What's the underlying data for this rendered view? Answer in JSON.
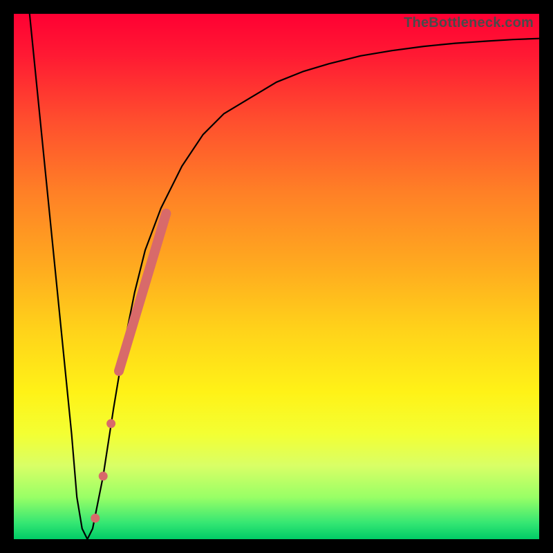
{
  "watermark": "TheBottleneck.com",
  "chart_data": {
    "type": "line",
    "title": "",
    "xlabel": "",
    "ylabel": "",
    "xlim": [
      0,
      100
    ],
    "ylim": [
      0,
      100
    ],
    "grid": false,
    "series": [
      {
        "name": "bottleneck-curve",
        "color": "#000000",
        "x": [
          3,
          5,
          7,
          9,
          11,
          12,
          13,
          14,
          15,
          17,
          19,
          21,
          23,
          25,
          28,
          32,
          36,
          40,
          45,
          50,
          55,
          60,
          66,
          72,
          78,
          84,
          90,
          95,
          100
        ],
        "y": [
          100,
          80,
          60,
          40,
          20,
          8,
          2,
          0,
          2,
          12,
          25,
          37,
          47,
          55,
          63,
          71,
          77,
          81,
          84,
          87,
          89,
          90.5,
          92,
          93,
          93.8,
          94.4,
          94.8,
          95.1,
          95.3
        ]
      }
    ],
    "markers": [
      {
        "name": "highlight-segment",
        "color": "#d86a6a",
        "shape": "thick-line",
        "x": [
          20,
          29
        ],
        "y": [
          32,
          62
        ]
      },
      {
        "name": "highlight-dots",
        "color": "#d86a6a",
        "shape": "dots",
        "points": [
          {
            "x": 18.5,
            "y": 22
          },
          {
            "x": 17.0,
            "y": 12
          },
          {
            "x": 15.5,
            "y": 4
          }
        ]
      }
    ]
  }
}
